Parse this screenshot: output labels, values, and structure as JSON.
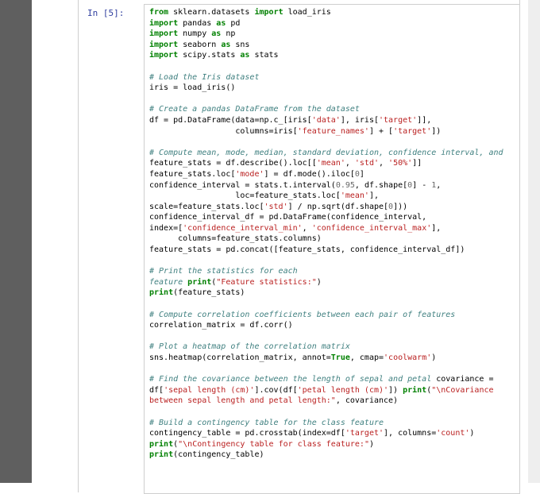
{
  "cell": {
    "prompt": "In [5]:",
    "lines": [
      [
        [
          "kw",
          "from"
        ],
        [
          "t",
          " sklearn.datasets "
        ],
        [
          "kw",
          "import"
        ],
        [
          "t",
          " load_iris"
        ]
      ],
      [
        [
          "kw",
          "import"
        ],
        [
          "t",
          " pandas "
        ],
        [
          "kw",
          "as"
        ],
        [
          "t",
          " pd"
        ]
      ],
      [
        [
          "kw",
          "import"
        ],
        [
          "t",
          " numpy "
        ],
        [
          "kw",
          "as"
        ],
        [
          "t",
          " np"
        ]
      ],
      [
        [
          "kw",
          "import"
        ],
        [
          "t",
          " seaborn "
        ],
        [
          "kw",
          "as"
        ],
        [
          "t",
          " sns"
        ]
      ],
      [
        [
          "kw",
          "import"
        ],
        [
          "t",
          " scipy.stats "
        ],
        [
          "kw",
          "as"
        ],
        [
          "t",
          " stats"
        ]
      ],
      [],
      [
        [
          "cm",
          "# Load the Iris dataset"
        ]
      ],
      [
        [
          "t",
          "iris = load_iris()"
        ]
      ],
      [],
      [
        [
          "cm",
          "# Create a pandas DataFrame from the dataset"
        ]
      ],
      [
        [
          "t",
          "df = pd.DataFrame(data=np.c_[iris["
        ],
        [
          "st",
          "'data'"
        ],
        [
          "t",
          "], iris["
        ],
        [
          "st",
          "'target'"
        ],
        [
          "t",
          "]],"
        ]
      ],
      [
        [
          "t",
          "                  columns=iris["
        ],
        [
          "st",
          "'feature_names'"
        ],
        [
          "t",
          "] + ["
        ],
        [
          "st",
          "'target'"
        ],
        [
          "t",
          "])"
        ]
      ],
      [],
      [
        [
          "cm",
          "# Compute mean, mode, median, standard deviation, confidence interval, and"
        ]
      ],
      [
        [
          "t",
          "feature_stats = df.describe().loc[["
        ],
        [
          "st",
          "'mean'"
        ],
        [
          "t",
          ", "
        ],
        [
          "st",
          "'std'"
        ],
        [
          "t",
          ", "
        ],
        [
          "st",
          "'50%'"
        ],
        [
          "t",
          "]]"
        ]
      ],
      [
        [
          "t",
          "feature_stats.loc["
        ],
        [
          "st",
          "'mode'"
        ],
        [
          "t",
          "] = df.mode().iloc["
        ],
        [
          "nu",
          "0"
        ],
        [
          "t",
          "]"
        ]
      ],
      [
        [
          "t",
          "confidence_interval = stats.t.interval("
        ],
        [
          "nu",
          "0.95"
        ],
        [
          "t",
          ", df.shape["
        ],
        [
          "nu",
          "0"
        ],
        [
          "t",
          "] - "
        ],
        [
          "nu",
          "1"
        ],
        [
          "t",
          ","
        ]
      ],
      [
        [
          "t",
          "                  loc=feature_stats.loc["
        ],
        [
          "st",
          "'mean'"
        ],
        [
          "t",
          "],"
        ]
      ],
      [
        [
          "t",
          "scale=feature_stats.loc["
        ],
        [
          "st",
          "'std'"
        ],
        [
          "t",
          "] / np.sqrt(df.shape["
        ],
        [
          "nu",
          "0"
        ],
        [
          "t",
          "]))"
        ]
      ],
      [
        [
          "t",
          "confidence_interval_df = pd.DataFrame(confidence_interval,"
        ]
      ],
      [
        [
          "t",
          "index=["
        ],
        [
          "st",
          "'confidence_interval_min'"
        ],
        [
          "t",
          ", "
        ],
        [
          "st",
          "'confidence_interval_max'"
        ],
        [
          "t",
          "],"
        ]
      ],
      [
        [
          "t",
          "      columns=feature_stats.columns)"
        ]
      ],
      [
        [
          "t",
          "feature_stats = pd.concat([feature_stats, confidence_interval_df])"
        ]
      ],
      [],
      [
        [
          "cm",
          "# Print the statistics for each"
        ]
      ],
      [
        [
          "cm",
          "feature "
        ],
        [
          "kw",
          "print"
        ],
        [
          "t",
          "("
        ],
        [
          "st",
          "\"Feature statistics:\""
        ],
        [
          "t",
          ")"
        ]
      ],
      [
        [
          "kw",
          "print"
        ],
        [
          "t",
          "(feature_stats)"
        ]
      ],
      [],
      [
        [
          "cm",
          "# Compute correlation coefficients between each pair of features"
        ]
      ],
      [
        [
          "t",
          "correlation_matrix = df.corr()"
        ]
      ],
      [],
      [
        [
          "cm",
          "# Plot a heatmap of the correlation matrix"
        ]
      ],
      [
        [
          "t",
          "sns.heatmap(correlation_matrix, annot="
        ],
        [
          "kw",
          "True"
        ],
        [
          "t",
          ", cmap="
        ],
        [
          "st",
          "'coolwarm'"
        ],
        [
          "t",
          ")"
        ]
      ],
      [],
      [
        [
          "cm",
          "# Find the covariance between the length of sepal and petal"
        ],
        [
          "t",
          " covariance ="
        ]
      ],
      [
        [
          "t",
          "df["
        ],
        [
          "st",
          "'sepal length (cm)'"
        ],
        [
          "t",
          "].cov(df["
        ],
        [
          "st",
          "'petal length (cm)'"
        ],
        [
          "t",
          "]) "
        ],
        [
          "kw",
          "print"
        ],
        [
          "t",
          "("
        ],
        [
          "st",
          "\"\\nCovariance"
        ]
      ],
      [
        [
          "st",
          "between sepal length and petal length:\""
        ],
        [
          "t",
          ", covariance)"
        ]
      ],
      [],
      [
        [
          "cm",
          "# Build a contingency table for the class feature"
        ]
      ],
      [
        [
          "t",
          "contingency_table = pd.crosstab(index=df["
        ],
        [
          "st",
          "'target'"
        ],
        [
          "t",
          "], columns="
        ],
        [
          "st",
          "'count'"
        ],
        [
          "t",
          ")"
        ]
      ],
      [
        [
          "kw",
          "print"
        ],
        [
          "t",
          "("
        ],
        [
          "st",
          "\"\\nContingency table for class feature:\""
        ],
        [
          "t",
          ")"
        ]
      ],
      [
        [
          "kw",
          "print"
        ],
        [
          "t",
          "(contingency_table)"
        ]
      ]
    ]
  }
}
